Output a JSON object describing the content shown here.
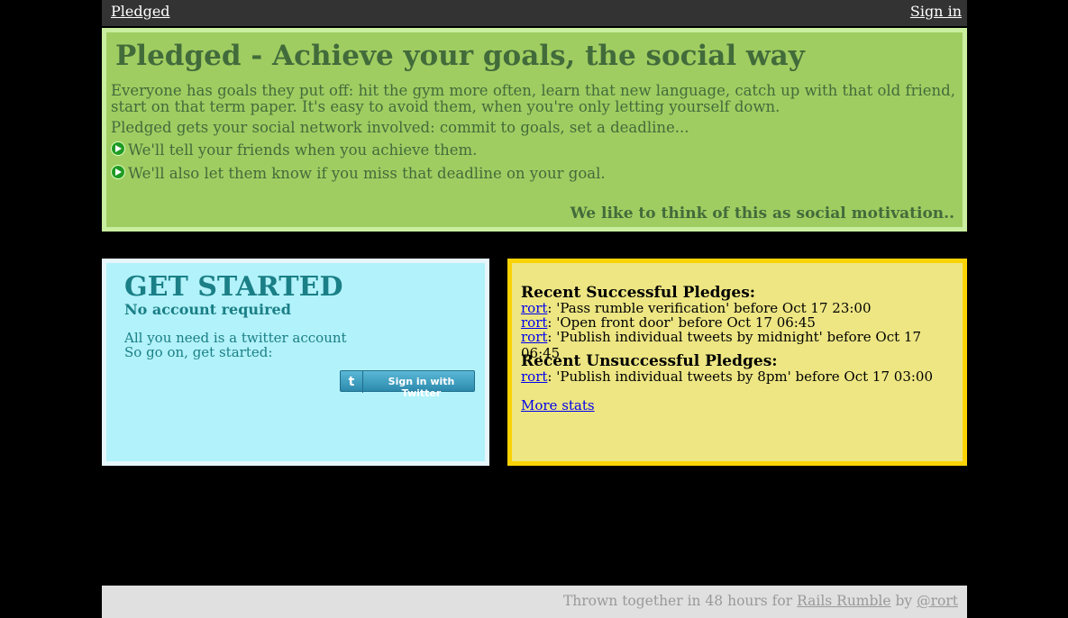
{
  "nav": {
    "brand": "Pledged",
    "signin": "Sign in"
  },
  "hero": {
    "title": "Pledged - Achieve your goals, the social way",
    "intro": "Everyone has goals they put off: hit the gym more often, learn that new language, catch up with that old friend, start on that term paper. It's easy to avoid them, when you're only letting yourself down.",
    "involve": "Pledged gets your social network involved: commit to goals, set a deadline...",
    "bullets": [
      "We'll tell your friends when you achieve them.",
      "We'll also let them know if you miss that deadline on your goal."
    ],
    "tagline": "We like to think of this as social motivation.."
  },
  "started": {
    "title": "GET STARTED",
    "subtitle": "No account required",
    "line1": "All you need is a twitter account",
    "line2": "So go on, get started:",
    "button": "Sign in with Twitter"
  },
  "stats": {
    "success_heading": "Recent Successful Pledges:",
    "success": [
      {
        "user": "rort",
        "text": ": 'Pass rumble verification' before Oct 17 23:00"
      },
      {
        "user": "rort",
        "text": ": 'Open front door' before Oct 17 06:45"
      },
      {
        "user": "rort",
        "text": ": 'Publish individual tweets by midnight' before Oct 17 06:45"
      }
    ],
    "fail_heading": "Recent Unsuccessful Pledges:",
    "fail": [
      {
        "user": "rort",
        "text": ": 'Publish individual tweets by 8pm' before Oct 17 03:00"
      }
    ],
    "more": "More stats"
  },
  "footer": {
    "prefix": "Thrown together in 48 hours for ",
    "rumble": "Rails Rumble",
    "by": " by ",
    "author": "@rort"
  }
}
